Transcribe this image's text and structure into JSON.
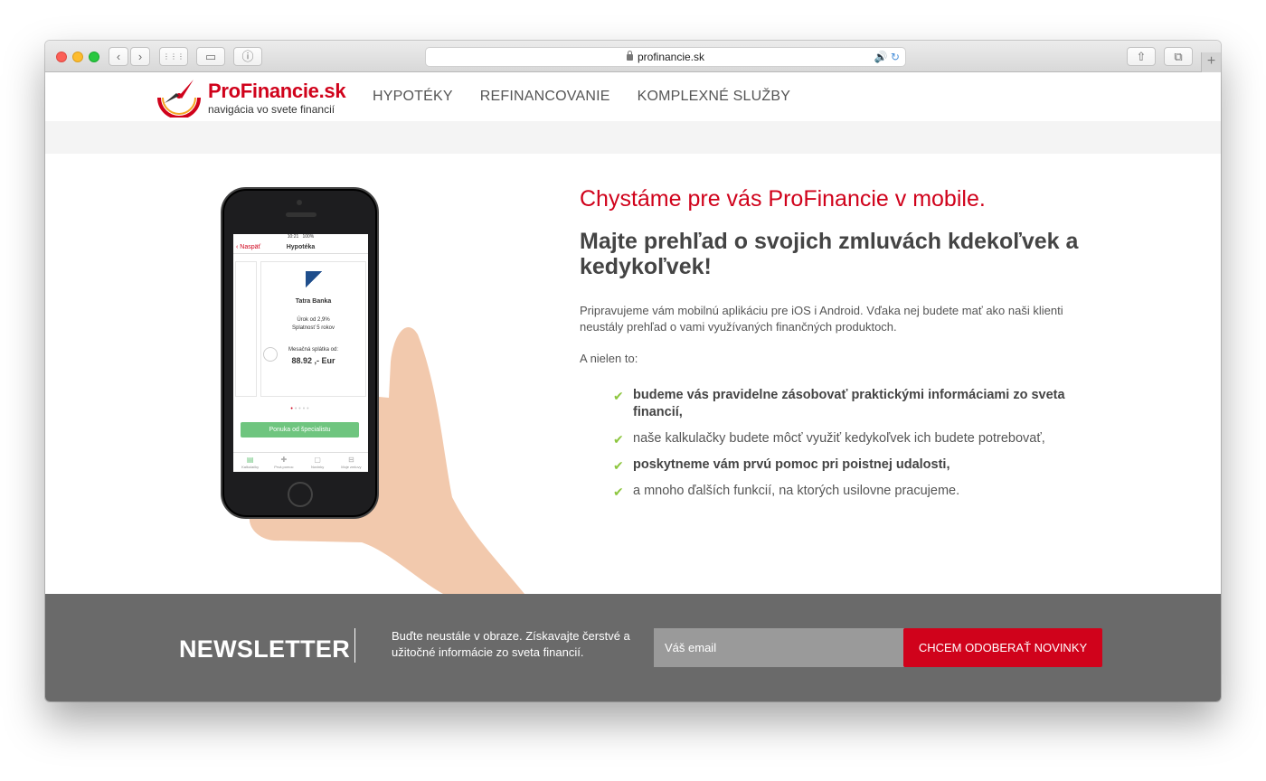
{
  "browser": {
    "url": "profinancie.sk",
    "buttons": {
      "back": "‹",
      "forward": "›",
      "grid": "⋮⋮⋮",
      "sidebar": "▭",
      "info": "ⓘ",
      "share": "⇧",
      "tabs": "⧉",
      "new_tab": "+"
    },
    "address_icons": "🔊 ↻"
  },
  "site": {
    "logo_title": "ProFinancie.sk",
    "logo_subtitle": "navigácia vo svete financií",
    "nav": [
      "HYPOTÉKY",
      "REFINANCOVANIE",
      "KOMPLEXNÉ SLUŽBY"
    ]
  },
  "phone": {
    "time": "10:21",
    "battery": "100%",
    "back": "‹ Naspäť",
    "title": "Hypotéka",
    "bank": "Tatra Banka",
    "rate": "Úrok od 2,9%",
    "term": "Splatnosť 5 rokov",
    "installment_label": "Mesačná splátka od:",
    "installment": "88.92 ,- Eur",
    "cta": "Ponuka od špecialistu",
    "tabs": [
      "Kalkulačky",
      "Prvá pomoc",
      "Novinky",
      "Moje zmluvy"
    ]
  },
  "hero": {
    "headline": "Chystáme pre vás ProFinancie v mobile.",
    "subheadline": "Majte prehľad o svojich zmluvách kdekoľvek a kedykoľvek!",
    "paragraph": "Pripravujeme vám mobilnú aplikáciu pre iOS i Android. Vďaka nej budete mať ako naši klienti neustály prehľad o vami využívaných finančných produktoch.",
    "lead": "A nielen to:",
    "bullets": [
      {
        "text": "budeme vás pravidelne zásobovať praktickými informáciami zo sveta financií,",
        "bold": true
      },
      {
        "text": "naše kalkulačky budete môcť využiť kedykoľvek ich budete potrebovať,",
        "bold": false
      },
      {
        "text": "poskytneme vám prvú pomoc pri poistnej udalosti,",
        "bold": true
      },
      {
        "text": "a mnoho ďalších funkcií, na ktorých usilovne pracujeme.",
        "bold": false
      }
    ]
  },
  "newsletter": {
    "title": "NEWSLETTER",
    "text": "Buďte neustále v obraze. Získavajte čerstvé a užitočné informácie zo sveta financií.",
    "placeholder": "Váš email",
    "button": "CHCEM ODOBERAŤ NOVINKY"
  },
  "colors": {
    "brand_red": "#d0021b",
    "check_green": "#8dc63f",
    "newsletter_bg": "#6a6a6a"
  }
}
